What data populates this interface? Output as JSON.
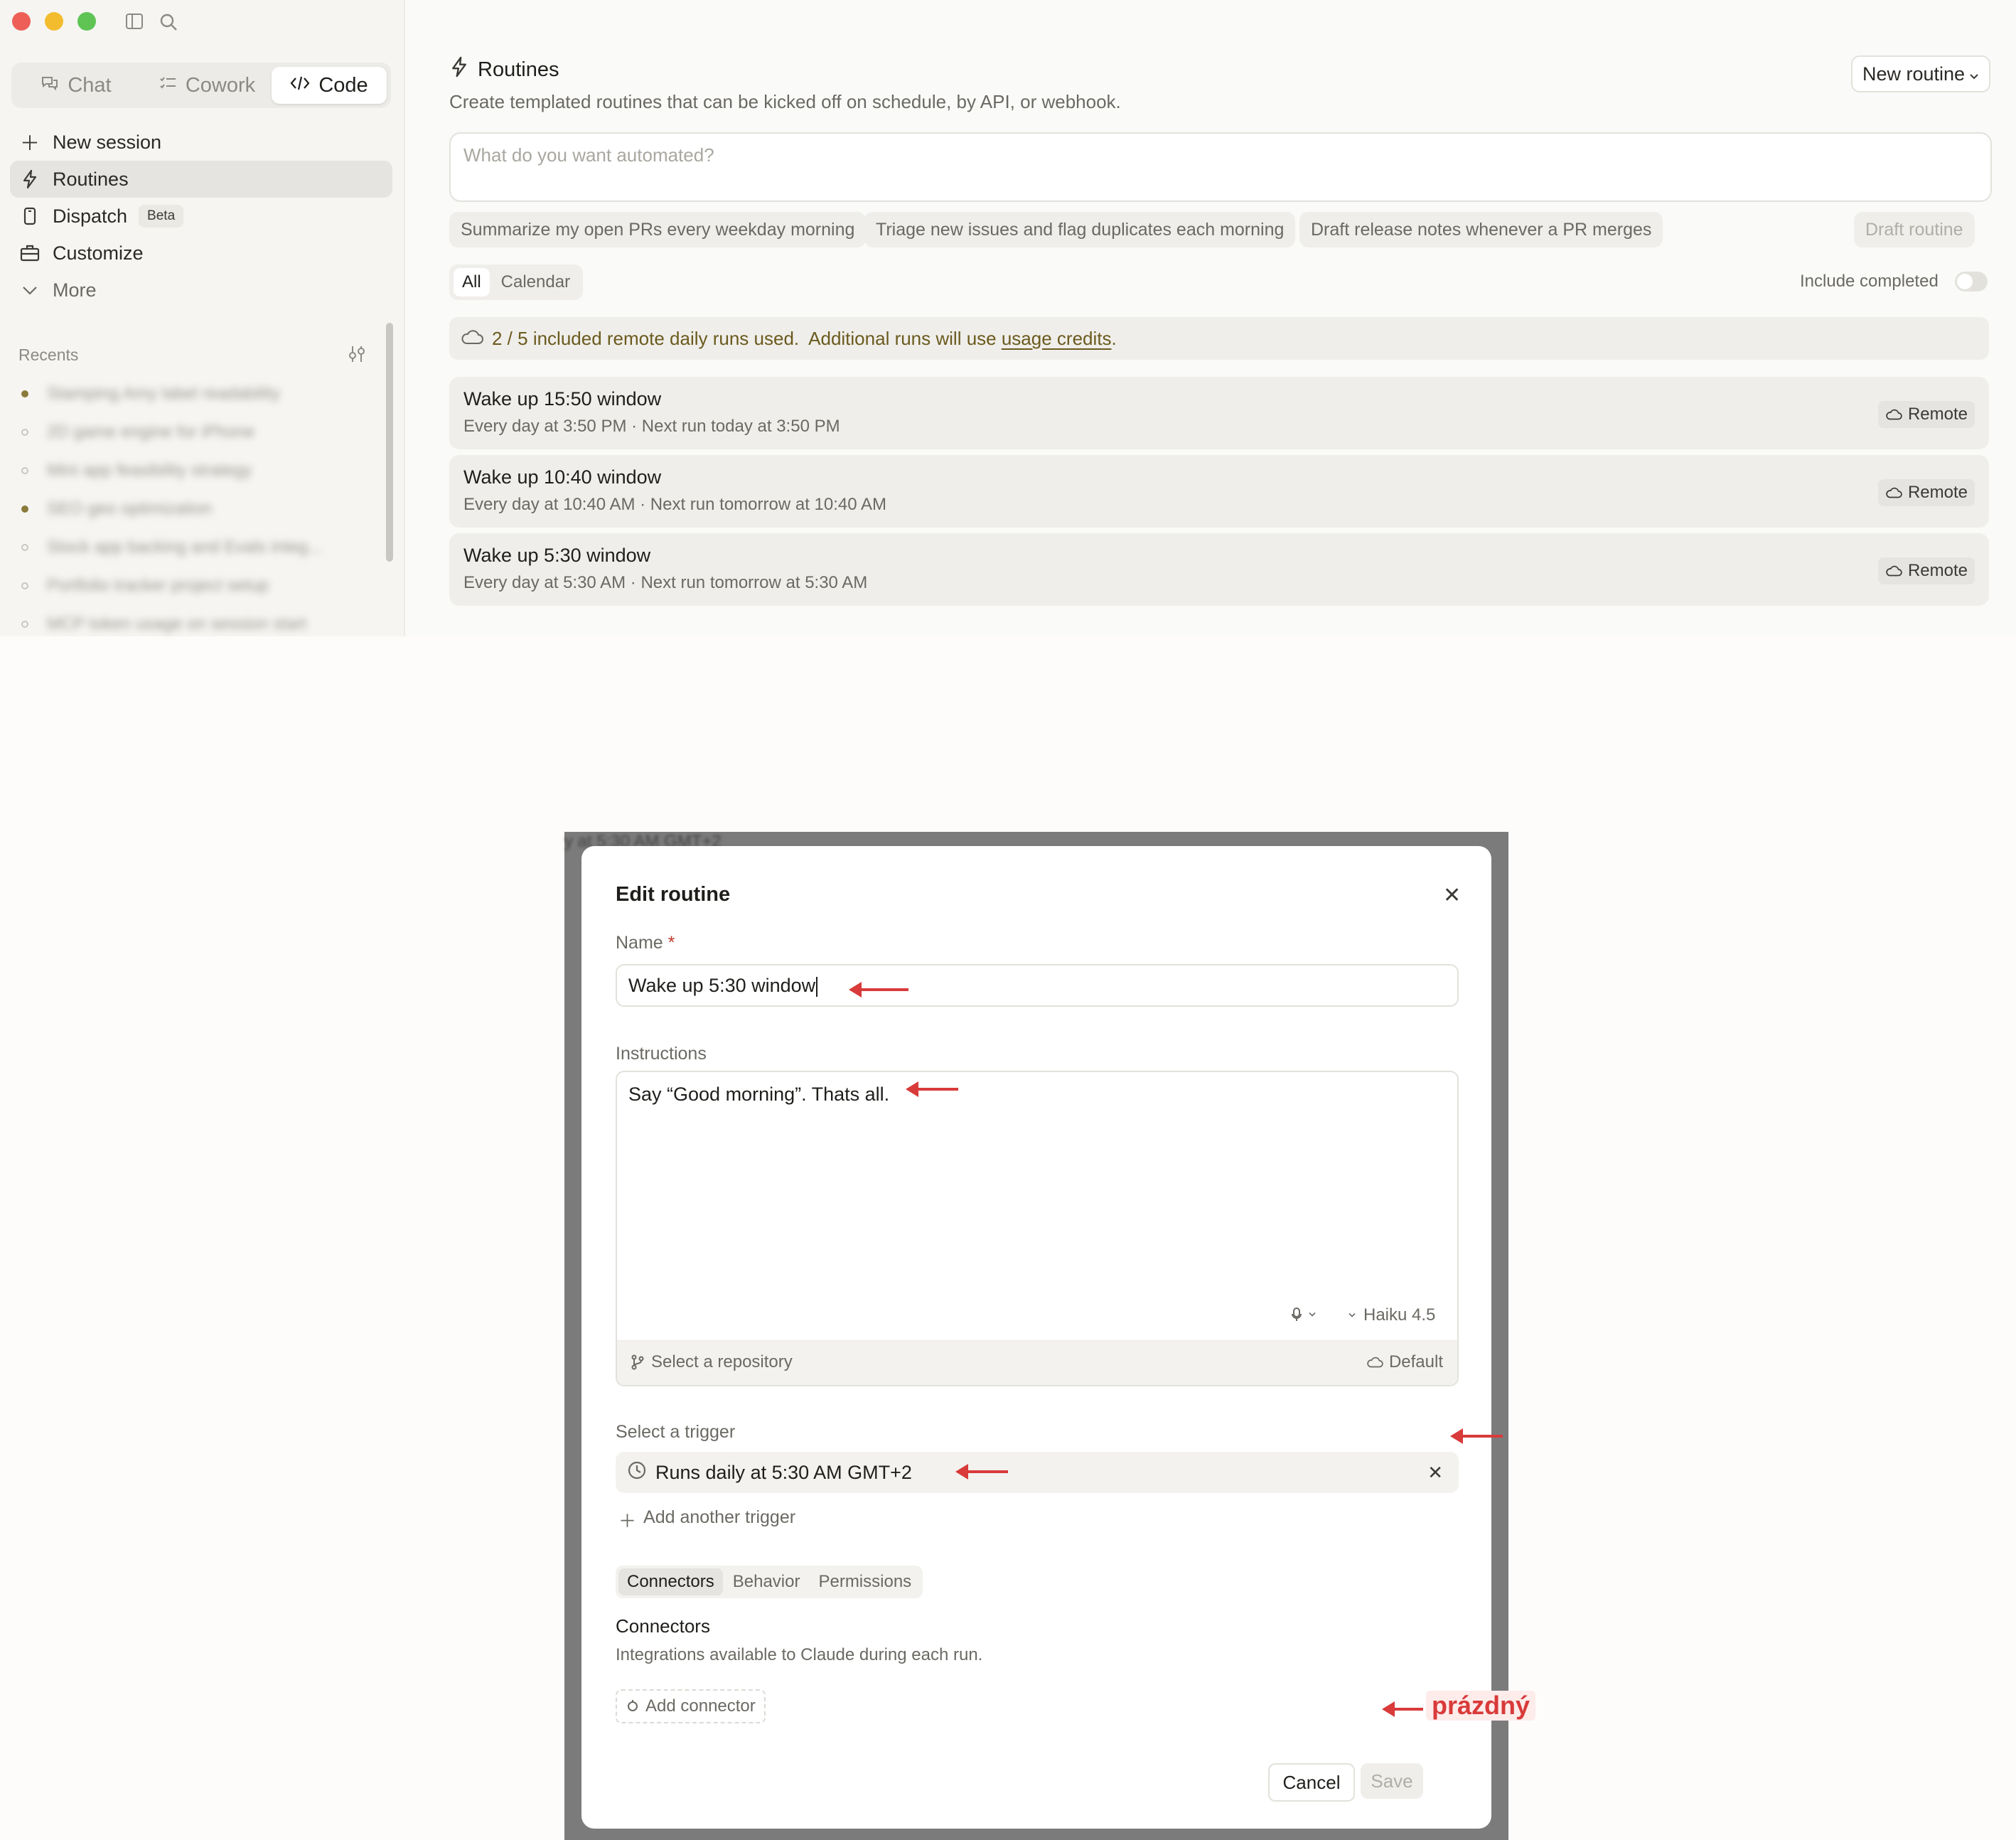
{
  "sidebar": {
    "mode_tabs": [
      {
        "label": "Chat",
        "icon": "chat-bubbles-icon"
      },
      {
        "label": "Cowork",
        "icon": "checklist-icon"
      },
      {
        "label": "Code",
        "icon": "code-brackets-icon",
        "active": true
      }
    ],
    "nav": [
      {
        "label": "New session",
        "icon": "plus-icon"
      },
      {
        "label": "Routines",
        "icon": "lightning-icon",
        "active": true
      },
      {
        "label": "Dispatch",
        "icon": "phone-icon",
        "badge": "Beta"
      },
      {
        "label": "Customize",
        "icon": "briefcase-icon"
      },
      {
        "label": "More",
        "icon": "chevron-down-icon"
      }
    ],
    "recents_label": "Recents",
    "recents": [
      {
        "text": "Stamping Amy label readability",
        "active": true
      },
      {
        "text": "2D game engine for iPhone",
        "active": false
      },
      {
        "text": "Mini app feasibility strategy",
        "active": false
      },
      {
        "text": "SEO geo optimization",
        "active": true
      },
      {
        "text": "Stock app backing and Evals integ...",
        "active": false
      },
      {
        "text": "Portfolio tracker project setup",
        "active": false
      },
      {
        "text": "MCP token usage on session start",
        "active": false
      }
    ]
  },
  "main": {
    "title": "Routines",
    "subtitle": "Create templated routines that can be kicked off on schedule, by API, or webhook.",
    "new_routine_label": "New routine",
    "prompt_placeholder": "What do you want automated?",
    "suggestions": [
      "Summarize my open PRs every weekday morning",
      "Triage new issues and flag duplicates each morning",
      "Draft release notes whenever a PR merges"
    ],
    "draft_routine_label": "Draft routine",
    "view_tabs": [
      {
        "label": "All",
        "active": true
      },
      {
        "label": "Calendar",
        "active": false
      }
    ],
    "include_completed_label": "Include completed",
    "include_completed": false,
    "notice_prefix": "2 / 5 included remote daily runs used.  Additional runs will use ",
    "notice_link": "usage credits",
    "notice_suffix": ".",
    "routines": [
      {
        "name": "Wake up 15:50 window",
        "schedule": "Every day at 3:50 PM · Next run today at 3:50 PM",
        "tag": "Remote"
      },
      {
        "name": "Wake up 10:40 window",
        "schedule": "Every day at 10:40 AM · Next run tomorrow at 10:40 AM",
        "tag": "Remote"
      },
      {
        "name": "Wake up 5:30 window",
        "schedule": "Every day at 5:30 AM · Next run tomorrow at 5:30 AM",
        "tag": "Remote"
      }
    ]
  },
  "modal": {
    "behind_text": "y at 5:30 AM GMT+2",
    "title": "Edit routine",
    "name_label": "Name",
    "name_required_mark": "*",
    "name_value": "Wake up 5:30 window",
    "instructions_label": "Instructions",
    "instructions_value": "Say “Good morning”. Thats all.",
    "model_label": "Haiku 4.5",
    "repo_label": "Select a repository",
    "environment_label": "Default",
    "trigger_label": "Select a trigger",
    "trigger_value": "Runs daily at 5:30 AM GMT+2",
    "add_trigger_label": "Add another trigger",
    "section_tabs": [
      {
        "label": "Connectors",
        "active": true
      },
      {
        "label": "Behavior",
        "active": false
      },
      {
        "label": "Permissions",
        "active": false
      }
    ],
    "connectors_title": "Connectors",
    "connectors_desc": "Integrations available to Claude during each run.",
    "add_connector_label": "Add connector",
    "annotation": "prázdný",
    "cancel_label": "Cancel",
    "save_label": "Save",
    "annotation_color": "#d93a3a"
  },
  "colors": {
    "accent_link": "#6b5a1e",
    "active_dot": "#8a7a3a",
    "window_red": "#ee5f57",
    "window_yellow": "#f3bc2f",
    "window_green": "#5fc454"
  }
}
